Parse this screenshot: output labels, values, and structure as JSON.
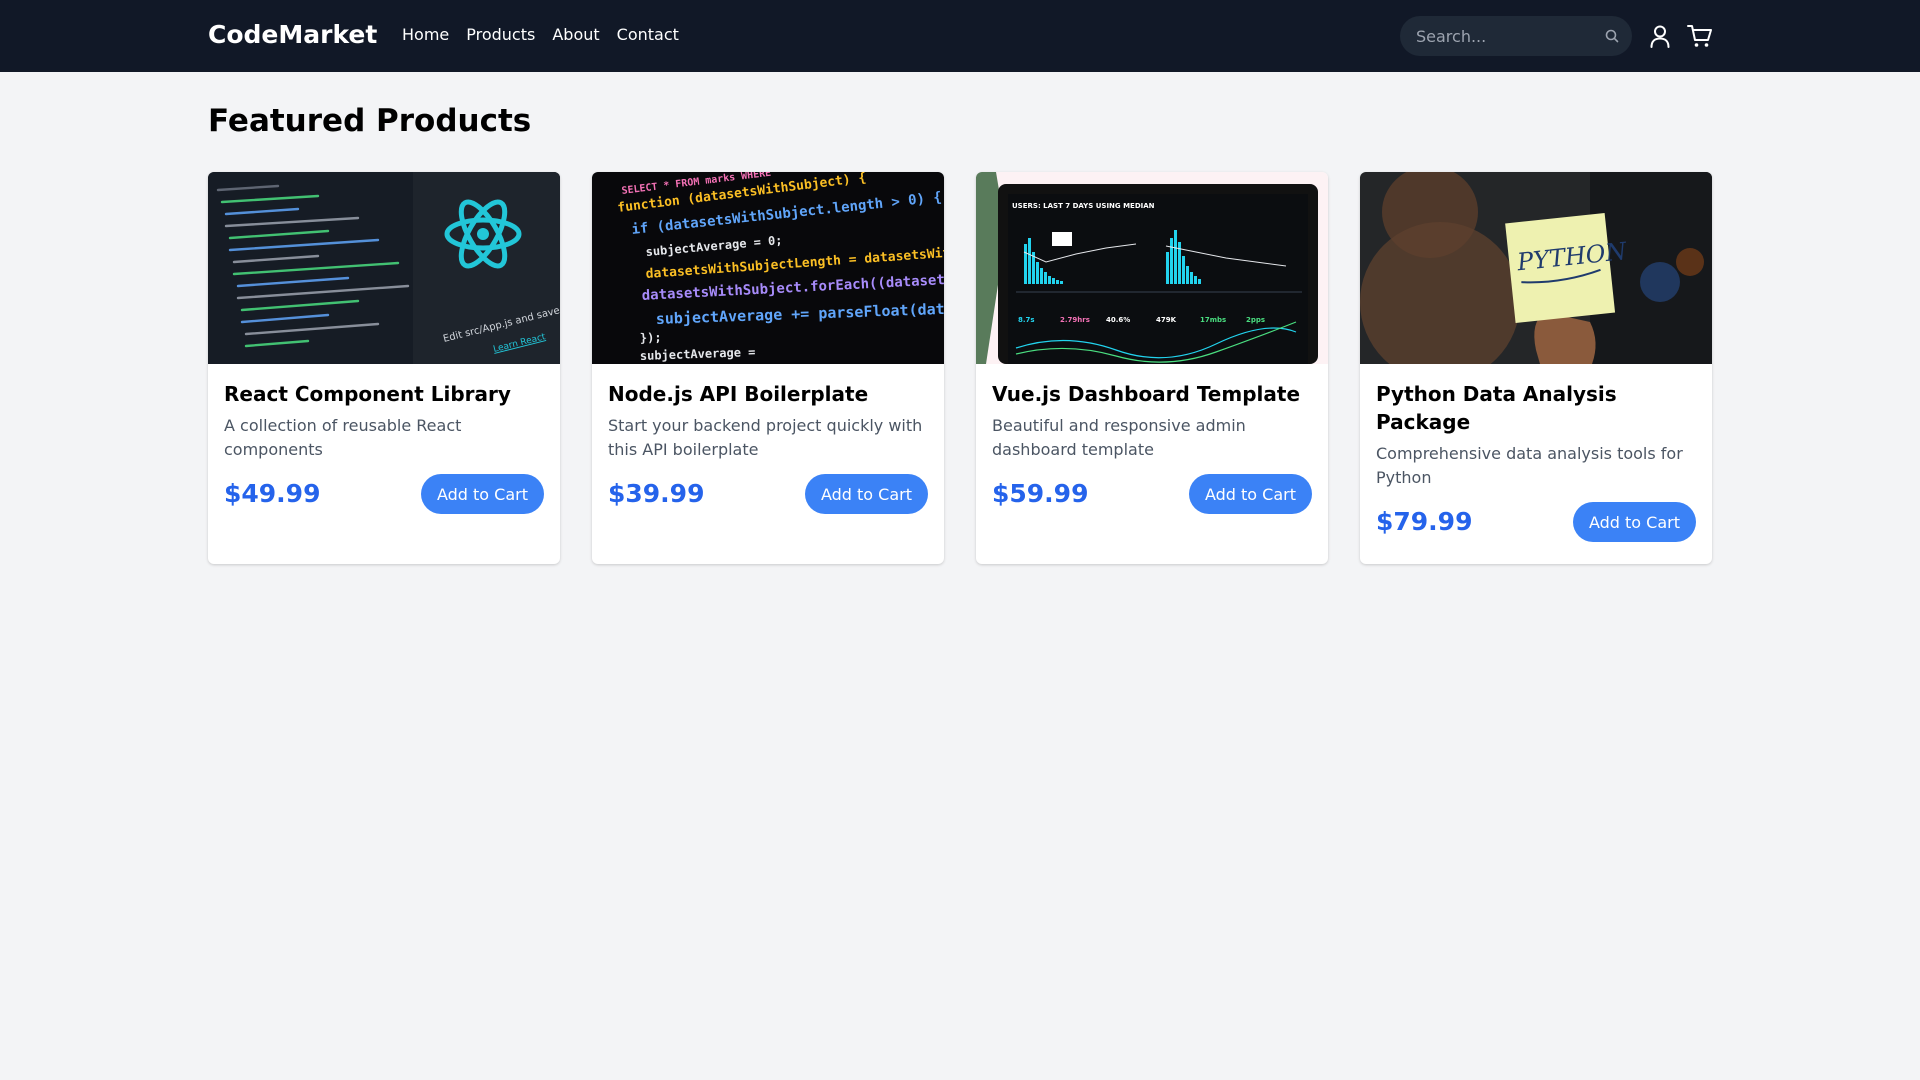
{
  "header": {
    "brand": "CodeMarket",
    "nav": [
      "Home",
      "Products",
      "About",
      "Contact"
    ],
    "search_placeholder": "Search...",
    "icons": [
      "search-icon",
      "user-icon",
      "cart-icon"
    ]
  },
  "main": {
    "title": "Featured Products",
    "products": [
      {
        "title": "React Component Library",
        "description": "A collection of reusable React components",
        "price": "$49.99",
        "button": "Add to Cart",
        "image_overlay": [
          "Edit src/App.js and save to reload.",
          "Learn React"
        ]
      },
      {
        "title": "Node.js API Boilerplate",
        "description": "Start your backend project quickly with this API boilerplate",
        "price": "$39.99",
        "button": "Add to Cart",
        "image_overlay": [
          "SELECT * FROM marks WHERE",
          "function (datasetsWithSubject) {",
          "if (datasetsWithSubject.length > 0) {",
          "subjectAverage = 0;",
          "datasetsWithSubjectLength = datasetsWithSu",
          "datasetsWithSubject.forEach((dataset) => {",
          "subjectAverage += parseFloat(dataset[",
          "});",
          "subjectAverage ="
        ]
      },
      {
        "title": "Vue.js Dashboard Template",
        "description": "Beautiful and responsive admin dashboard template",
        "price": "$59.99",
        "button": "Add to Cart",
        "image_overlay": [
          "USERS: LAST 7 DAYS USING MEDIAN",
          "8.7s",
          "2.79hrs",
          "40.6%",
          "479K",
          "17mbs",
          "2pps"
        ]
      },
      {
        "title": "Python Data Analysis Package",
        "description": "Comprehensive data analysis tools for Python",
        "price": "$79.99",
        "button": "Add to Cart",
        "image_overlay": [
          "PYTHON"
        ]
      }
    ]
  },
  "colors": {
    "header_bg": "#111827",
    "page_bg": "#f3f4f6",
    "accent": "#3b82f6",
    "price": "#2563eb"
  }
}
